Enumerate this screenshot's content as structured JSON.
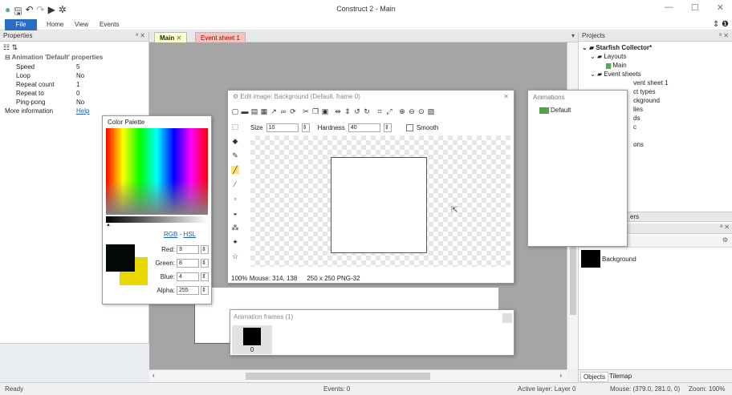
{
  "window": {
    "title": "Construct 2 - Main"
  },
  "ribbon": {
    "tabs": [
      "File",
      "Home",
      "View",
      "Events"
    ]
  },
  "properties": {
    "header": "Properties",
    "section": "Animation 'Default' properties",
    "rows": [
      {
        "key": "Speed",
        "value": "5"
      },
      {
        "key": "Loop",
        "value": "No"
      },
      {
        "key": "Repeat count",
        "value": "1"
      },
      {
        "key": "Repeat to",
        "value": "0"
      },
      {
        "key": "Ping-pong",
        "value": "No"
      }
    ],
    "more_info": "More information",
    "help": "Help"
  },
  "tabs": {
    "main": "Main",
    "event_sheet": "Event sheet 1"
  },
  "projects": {
    "header": "Projects",
    "project_name": "Starfish Collector*",
    "layouts": "Layouts",
    "layout_main": "Main",
    "event_sheets": "Event sheets",
    "event_sheet_1": "vent sheet 1",
    "obj_types": "ct types",
    "background": "ckground",
    "families": "lies",
    "sounds": "ds",
    "music": "c",
    "files": "ons",
    "layers_header": "ers",
    "object_name": "Background",
    "bottom_tabs": [
      "Objects",
      "Tilemap"
    ]
  },
  "color_palette": {
    "title": "Color Palette",
    "mode_rgb": "RGB",
    "mode_sep": " - ",
    "mode_hsl": "HSL",
    "red_label": "Red:",
    "red": "3",
    "green_label": "Green:",
    "green": "8",
    "blue_label": "Blue:",
    "blue": "4",
    "alpha_label": "Alpha:",
    "alpha": "255",
    "primary_color": "#030804",
    "secondary_color": "#e8d800"
  },
  "edit_image": {
    "title": "Edit image: Background (Default, frame 0)",
    "size_label": "Size",
    "size_value": "10",
    "hardness_label": "Hardness",
    "hardness_value": "40",
    "smooth_label": "Smooth",
    "status_zoom": "100%",
    "status_mouse": "Mouse: 314, 138",
    "status_size": "250 x 250",
    "status_format": "PNG-32"
  },
  "animations": {
    "title": "Animations",
    "item": "Default"
  },
  "animation_frames": {
    "title": "Animation frames (1)",
    "frame_index": "0"
  },
  "status": {
    "ready": "Ready",
    "events": "Events: 0",
    "active_layer": "Active layer: Layer 0",
    "mouse": "Mouse: (379.0, 281.0, 0)",
    "zoom": "Zoom: 100%"
  }
}
